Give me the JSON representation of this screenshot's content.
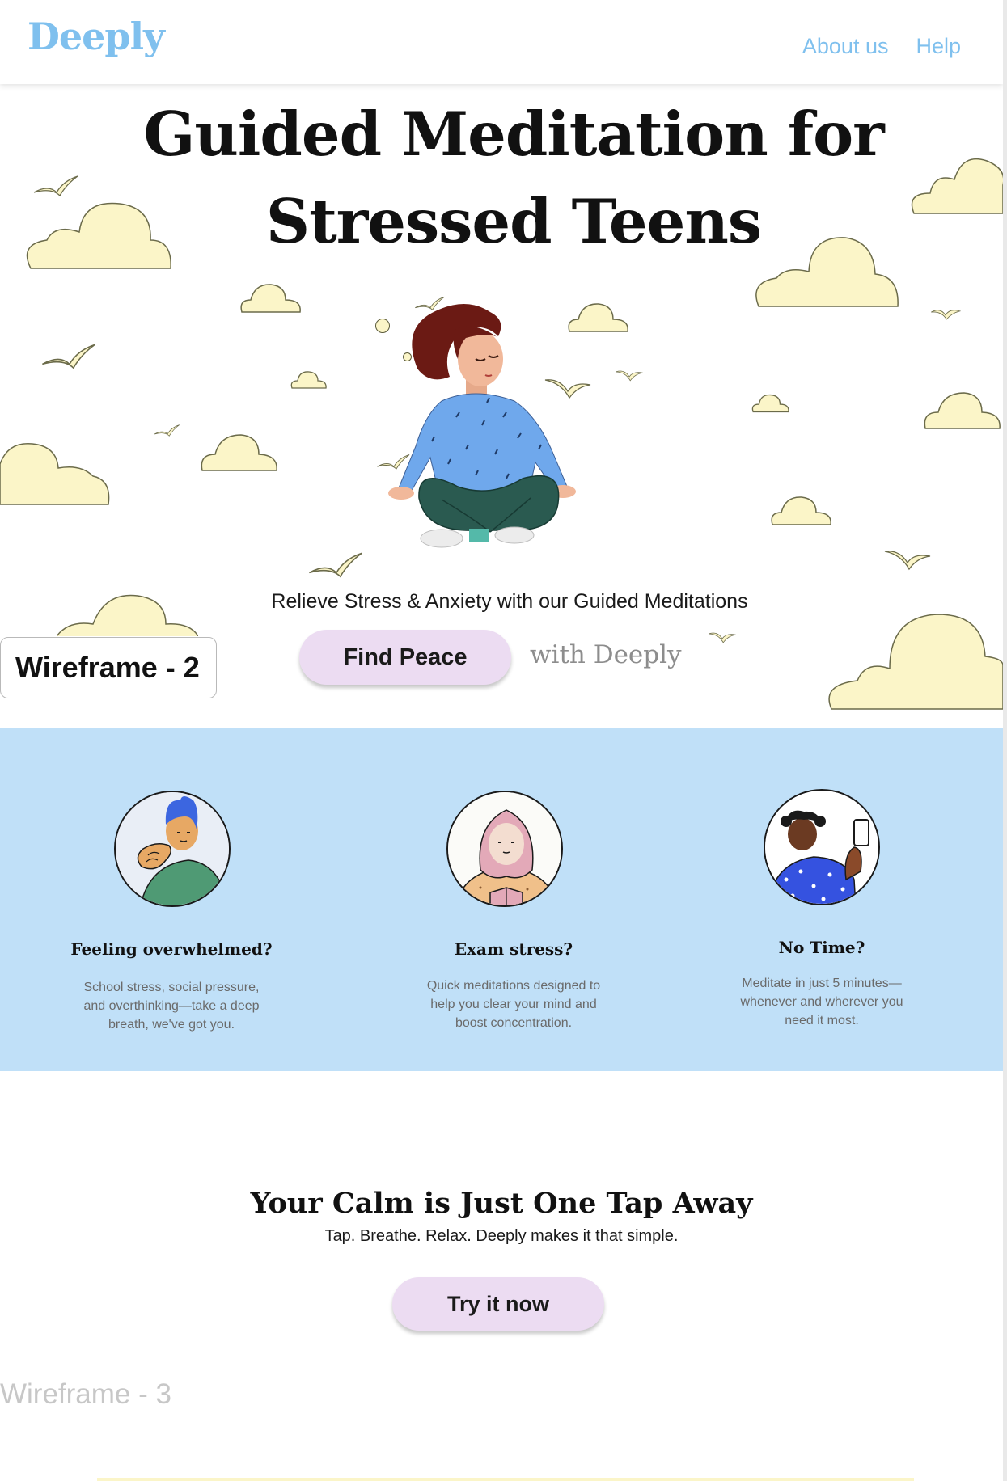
{
  "header": {
    "logo": "Deeply",
    "nav": [
      "About us",
      "Help"
    ]
  },
  "hero": {
    "title_line1": "Guided Meditation for",
    "title_line2": "Stressed Teens",
    "subtitle": "Relieve Stress & Anxiety with our Guided Meditations",
    "cta_label": "Find Peace",
    "cta_suffix": "with Deeply"
  },
  "frame_labels": {
    "wireframe2": "Wireframe - 2",
    "wireframe3": "Wireframe - 3"
  },
  "features": [
    {
      "title": "Feeling overwhelmed?",
      "description": "School stress, social pressure, and overthinking—take a deep breath, we've got you."
    },
    {
      "title": "Exam stress?",
      "description": "Quick meditations designed to help you clear your mind and boost concentration."
    },
    {
      "title": "No Time?",
      "description": "Meditate in just 5 minutes—whenever and wherever you need it most."
    }
  ],
  "cta": {
    "title": "Your Calm is Just One Tap Away",
    "subtitle": "Tap. Breathe. Relax. Deeply makes it that simple.",
    "button_label": "Try it now"
  },
  "colors": {
    "brand": "#7fc0ee",
    "feature_band": "#c0e0f8",
    "button": "#ecdcf2",
    "cloud": "#fbf5c8"
  }
}
